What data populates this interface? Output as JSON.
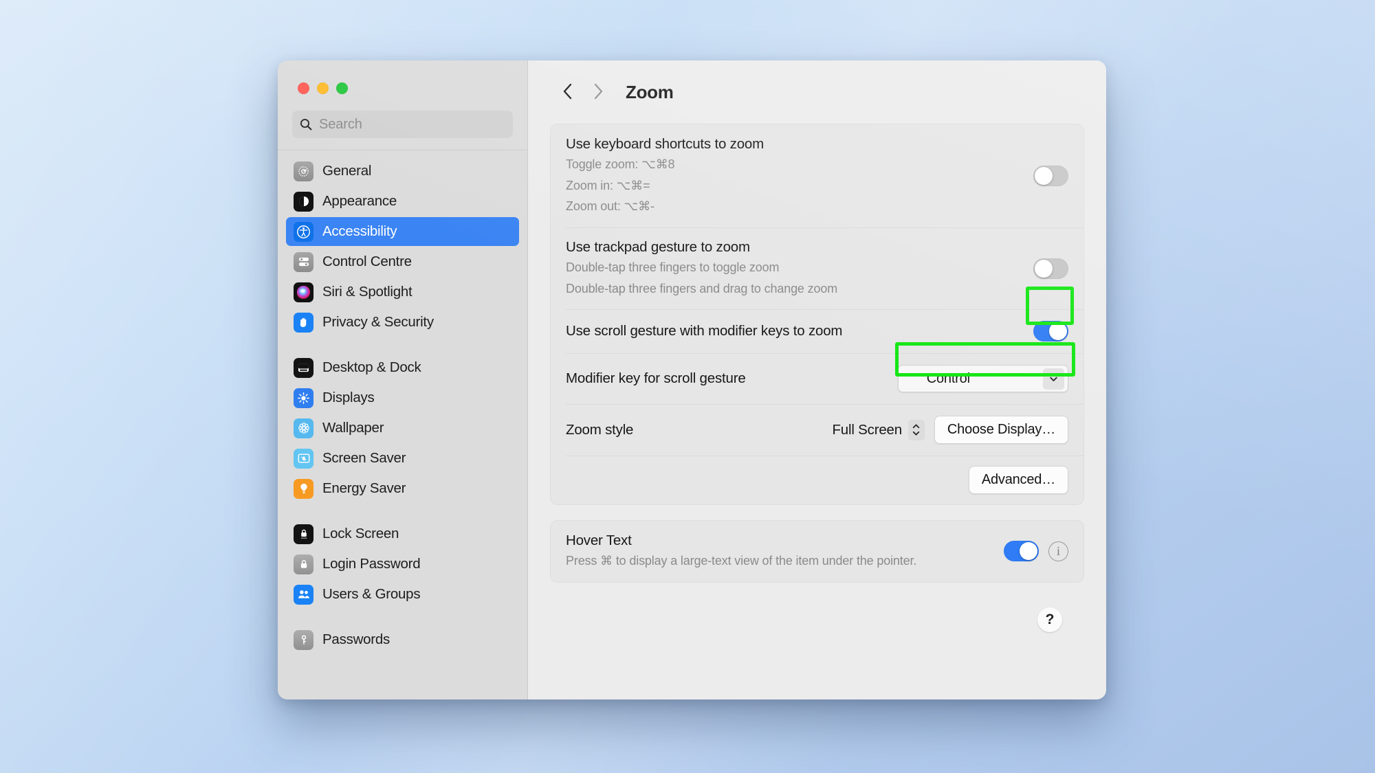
{
  "window": {
    "traffic_lights": [
      "close",
      "minimize",
      "zoom"
    ],
    "colors": {
      "accent": "#2f7cf6",
      "selection": "#3b84f3",
      "highlight": "#13e613"
    }
  },
  "search": {
    "placeholder": "Search",
    "value": "",
    "icon": "search-icon"
  },
  "sidebar": {
    "groups": [
      {
        "items": [
          {
            "label": "General",
            "icon": "gear-icon",
            "selected": false
          },
          {
            "label": "Appearance",
            "icon": "appearance-icon",
            "selected": false
          },
          {
            "label": "Accessibility",
            "icon": "accessibility-icon",
            "selected": true
          },
          {
            "label": "Control Centre",
            "icon": "control-centre-icon",
            "selected": false
          },
          {
            "label": "Siri & Spotlight",
            "icon": "siri-icon",
            "selected": false
          },
          {
            "label": "Privacy & Security",
            "icon": "privacy-hand-icon",
            "selected": false
          }
        ]
      },
      {
        "items": [
          {
            "label": "Desktop & Dock",
            "icon": "desktop-dock-icon",
            "selected": false
          },
          {
            "label": "Displays",
            "icon": "displays-icon",
            "selected": false
          },
          {
            "label": "Wallpaper",
            "icon": "wallpaper-icon",
            "selected": false
          },
          {
            "label": "Screen Saver",
            "icon": "screen-saver-icon",
            "selected": false
          },
          {
            "label": "Energy Saver",
            "icon": "energy-saver-icon",
            "selected": false
          }
        ]
      },
      {
        "items": [
          {
            "label": "Lock Screen",
            "icon": "lock-screen-icon",
            "selected": false
          },
          {
            "label": "Login Password",
            "icon": "login-password-icon",
            "selected": false
          },
          {
            "label": "Users & Groups",
            "icon": "users-groups-icon",
            "selected": false
          }
        ]
      },
      {
        "items": [
          {
            "label": "Passwords",
            "icon": "passwords-key-icon",
            "selected": false
          }
        ]
      }
    ]
  },
  "toolbar": {
    "back_icon": "chevron-left-icon",
    "forward_icon": "chevron-right-icon",
    "title": "Zoom"
  },
  "main": {
    "zoom_card": {
      "keyboard_shortcuts": {
        "title": "Use keyboard shortcuts to zoom",
        "lines": [
          "Toggle zoom: ⌥⌘8",
          "Zoom in: ⌥⌘=",
          "Zoom out: ⌥⌘-"
        ],
        "toggle_on": false
      },
      "trackpad_gesture": {
        "title": "Use trackpad gesture to zoom",
        "lines": [
          "Double-tap three fingers to toggle zoom",
          "Double-tap three fingers and drag to change zoom"
        ],
        "toggle_on": false
      },
      "scroll_gesture": {
        "title": "Use scroll gesture with modifier keys to zoom",
        "toggle_on": true,
        "highlighted": true
      },
      "modifier_key": {
        "title": "Modifier key for scroll gesture",
        "symbol": "⌃",
        "value": "Control",
        "highlighted": true,
        "chevron_icon": "chevron-down-icon"
      },
      "zoom_style": {
        "title": "Zoom style",
        "value": "Full Screen",
        "stepper_icon": "up-down-chevrons-icon",
        "button_label": "Choose Display…"
      },
      "advanced": {
        "button_label": "Advanced…"
      }
    },
    "hover_text_card": {
      "title": "Hover Text",
      "subtitle": "Press ⌘ to display a large-text view of the item under the pointer.",
      "toggle_on": true,
      "info_icon": "info-circle-icon",
      "info_label": "i"
    },
    "help": {
      "label": "?",
      "icon": "help-icon"
    }
  }
}
